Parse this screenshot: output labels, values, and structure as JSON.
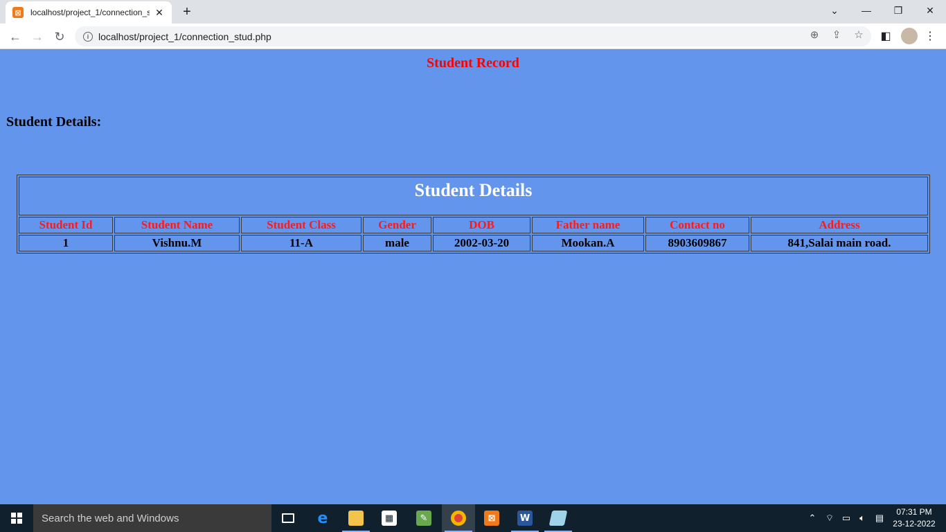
{
  "browser": {
    "tab_title": "localhost/project_1/connection_s",
    "tab_close": "✕",
    "new_tab": "+",
    "url": "localhost/project_1/connection_stud.php"
  },
  "page": {
    "title": "Student Record",
    "section_heading": "Student Details:",
    "table": {
      "caption": "Student Details",
      "headers": [
        "Student Id",
        "Student Name",
        "Student Class",
        "Gender",
        "DOB",
        "Father name",
        "Contact no",
        "Address"
      ],
      "rows": [
        [
          "1",
          "Vishnu.M",
          "11-A",
          "male",
          "2002-03-20",
          "Mookan.A",
          "8903609867",
          "841,Salai main road."
        ]
      ]
    }
  },
  "taskbar": {
    "search_placeholder": "Search the web and Windows",
    "time": "07:31 PM",
    "date": "23-12-2022"
  },
  "colors": {
    "page_background": "#6495ed",
    "title_red": "#ff0000",
    "caption_white": "#ffffff"
  }
}
